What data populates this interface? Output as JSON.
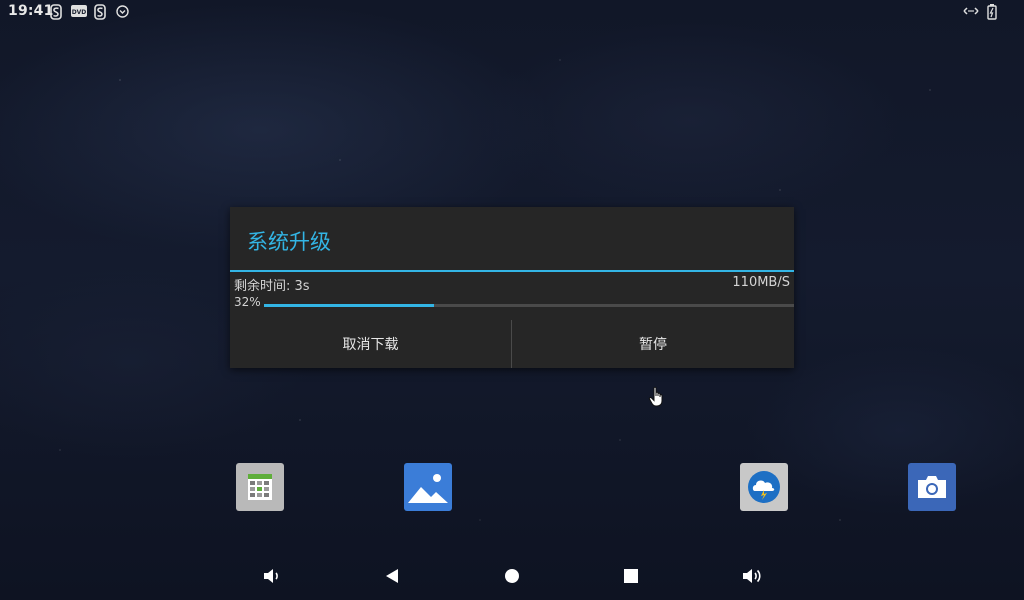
{
  "status_bar": {
    "time": "19:41",
    "left_icons": [
      "s-app-icon",
      "dvd-icon",
      "s-app-icon",
      "circle-down-icon"
    ],
    "right_icons": [
      "ethernet-arrows-icon",
      "battery-icon"
    ]
  },
  "dialog": {
    "title": "系统升级",
    "remaining_time": "剩余时间: 3s",
    "speed": "110MB/S",
    "percent_label": "32%",
    "progress": 0.32,
    "cancel_label": "取消下载",
    "pause_label": "暂停"
  },
  "dock": {
    "apps": [
      "calendar-grid-icon",
      "gallery-icon",
      "weather-icon",
      "camera-icon"
    ]
  },
  "nav_bar": {
    "buttons": [
      "volume-down-icon",
      "back-icon",
      "home-icon",
      "recents-icon",
      "volume-up-icon"
    ]
  },
  "colors": {
    "accent": "#33b5e5",
    "dialog_bg": "#262626",
    "text": "#e6e6e6"
  }
}
